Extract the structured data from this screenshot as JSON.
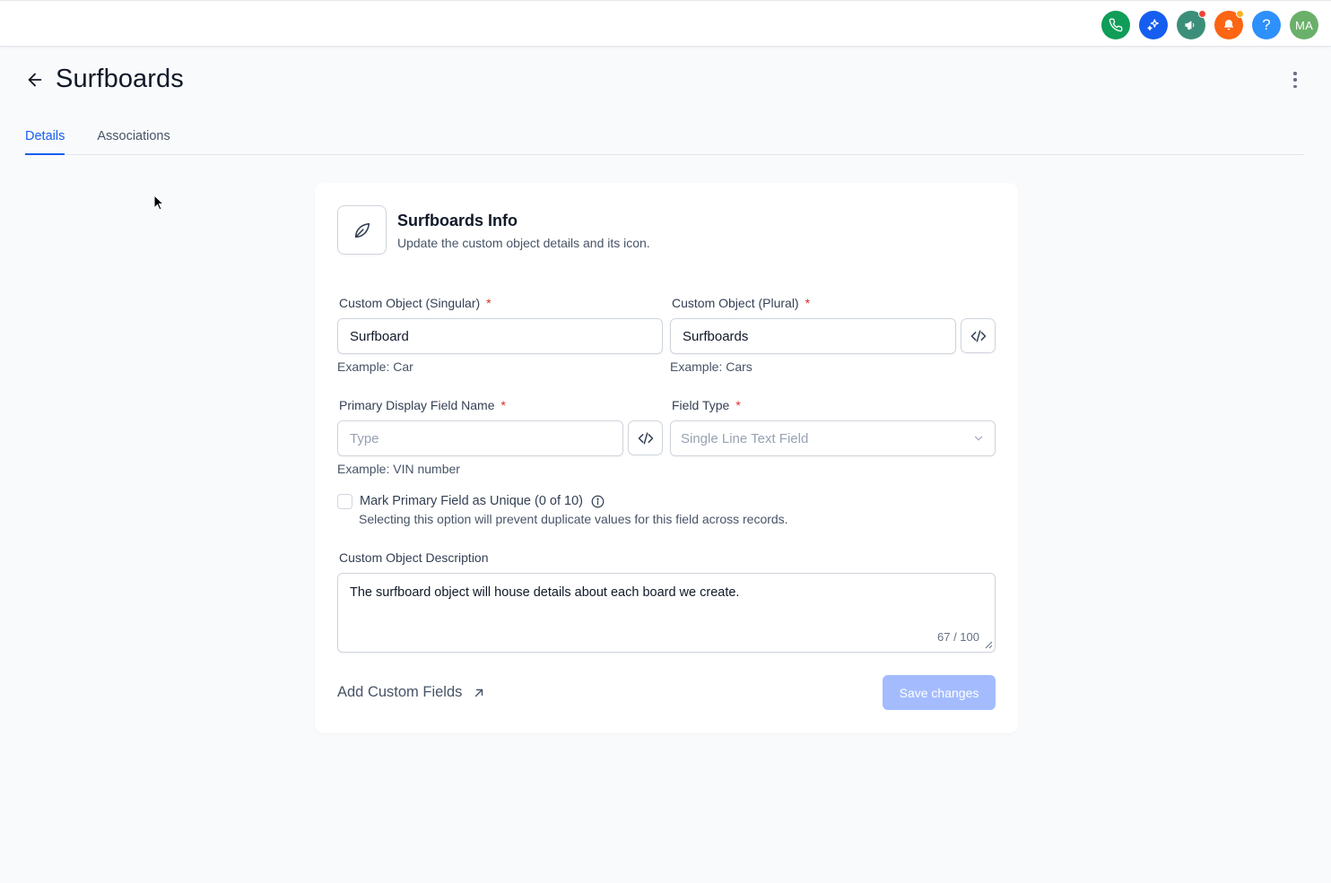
{
  "topbar": {
    "icons": [
      {
        "name": "phone-icon",
        "color": "#0f9d58"
      },
      {
        "name": "sparkle-icon",
        "color": "#155eef"
      },
      {
        "name": "megaphone-icon",
        "color": "#3b8f7a",
        "dot": "#f04438"
      },
      {
        "name": "bell-icon",
        "color": "#fb6514",
        "dot": "#fdb022"
      },
      {
        "name": "help-icon",
        "color": "#2e90fa",
        "glyph": "?"
      }
    ],
    "avatar": {
      "initials": "MA",
      "color": "#6ab06a"
    }
  },
  "page": {
    "title": "Surfboards"
  },
  "tabs": [
    {
      "label": "Details",
      "active": true
    },
    {
      "label": "Associations",
      "active": false
    }
  ],
  "card": {
    "title": "Surfboards Info",
    "subtitle": "Update the custom object details and its icon.",
    "icon": "surfboard-icon",
    "singular": {
      "label": "Custom Object (Singular)",
      "required": "*",
      "value": "Surfboard",
      "hint": "Example: Car"
    },
    "plural": {
      "label": "Custom Object (Plural)",
      "required": "*",
      "value": "Surfboards",
      "hint": "Example: Cars"
    },
    "primary_field": {
      "label": "Primary Display Field Name",
      "required": "*",
      "value": "",
      "placeholder": "Type",
      "hint": "Example: VIN number"
    },
    "field_type": {
      "label": "Field Type",
      "required": "*",
      "value": "Single Line Text Field"
    },
    "unique": {
      "label": "Mark Primary Field as Unique (0 of 10)",
      "description": "Selecting this option will prevent duplicate values for this field across records."
    },
    "description": {
      "label": "Custom Object Description",
      "value": "The surfboard object will house details about each board we create.",
      "counter": "67 / 100"
    },
    "add_fields_label": "Add Custom Fields",
    "save_label": "Save changes"
  },
  "colors": {
    "accent": "#155eef",
    "save_disabled": "#a4bcfd",
    "required": "#d92d20"
  }
}
